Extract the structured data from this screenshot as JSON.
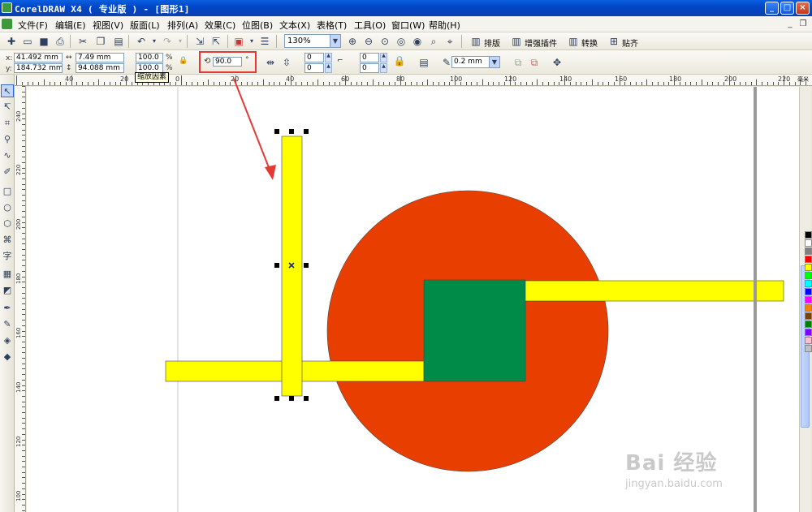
{
  "window": {
    "title": "CorelDRAW X4 ( 专业版 ) - [图形1]",
    "minimize": "_",
    "maximize": "□",
    "close": "×"
  },
  "menu": {
    "items": [
      {
        "label": "文件(F)"
      },
      {
        "label": "编辑(E)"
      },
      {
        "label": "视图(V)"
      },
      {
        "label": "版面(L)"
      },
      {
        "label": "排列(A)"
      },
      {
        "label": "效果(C)"
      },
      {
        "label": "位图(B)"
      },
      {
        "label": "文本(X)"
      },
      {
        "label": "表格(T)"
      },
      {
        "label": "工具(O)"
      },
      {
        "label": "窗口(W)"
      },
      {
        "label": "帮助(H)"
      }
    ],
    "doc_minimize": "_",
    "doc_restore": "❐"
  },
  "toolbar": {
    "zoom": "130%",
    "layout_label": "排版",
    "plugin_label": "增强插件",
    "convert_label": "转换",
    "align_label": "贴齐"
  },
  "propbar": {
    "x_label": "x:",
    "y_label": "y:",
    "x_value": "41.492 mm",
    "y_value": "184.732 mm",
    "width": "7.49 mm",
    "height": "94.088 mm",
    "scale_x": "100.0",
    "scale_y": "100.0",
    "percent": "%",
    "rotation": "90.0",
    "degree": "°",
    "corner_a": "0",
    "corner_b": "0",
    "corner_c": "0",
    "corner_d": "0",
    "outline_width": "0.2 mm",
    "tooltip": "缩放因素"
  },
  "rulers": {
    "unit": "毫米",
    "h_labels": [
      "40",
      "20",
      "0",
      "20",
      "40",
      "60",
      "80",
      "100",
      "120",
      "140",
      "160",
      "180",
      "200",
      "220"
    ],
    "v_labels": [
      "240",
      "220",
      "200",
      "180",
      "160",
      "140",
      "120",
      "100"
    ]
  },
  "canvas": {
    "circle_color": "#e83f00",
    "square_color": "#008c48",
    "bar_color": "#ffff00"
  },
  "palette": [
    "#000000",
    "#ffffff",
    "#808080",
    "#ff0000",
    "#ffff00",
    "#00ff00",
    "#00ffff",
    "#0000ff",
    "#ff00ff",
    "#ff8000",
    "#804000",
    "#008000",
    "#8000ff",
    "#ffc0cb",
    "#c0c0c0"
  ],
  "watermark": {
    "main": "Bai 经验",
    "sub": "jingyan.baidu.com"
  }
}
